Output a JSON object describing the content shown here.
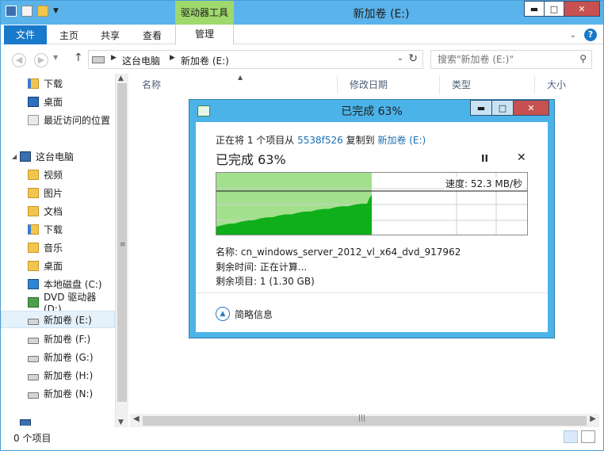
{
  "window": {
    "title": "新加卷 (E:)",
    "context_tab": "驱动器工具",
    "controls": {
      "minimize": "▬",
      "maximize": "□",
      "close": "✕"
    }
  },
  "ribbon": {
    "file_tab": "文件",
    "tabs": [
      "主页",
      "共享",
      "查看",
      "管理"
    ]
  },
  "address": {
    "crumbs": [
      "这台电脑",
      "新加卷 (E:)"
    ],
    "search_placeholder": "搜索\"新加卷 (E:)\""
  },
  "nav_pane": {
    "items": [
      {
        "label": "下载",
        "icon": "downloads-folder-icon"
      },
      {
        "label": "桌面",
        "icon": "desktop-icon"
      },
      {
        "label": "最近访问的位置",
        "icon": "recent-places-icon"
      },
      {
        "label": "这台电脑",
        "icon": "computer-icon"
      },
      {
        "label": "视频",
        "icon": "folder-icon"
      },
      {
        "label": "图片",
        "icon": "folder-icon"
      },
      {
        "label": "文档",
        "icon": "folder-icon"
      },
      {
        "label": "下载",
        "icon": "downloads-folder-icon"
      },
      {
        "label": "音乐",
        "icon": "folder-icon"
      },
      {
        "label": "桌面",
        "icon": "folder-icon"
      },
      {
        "label": "本地磁盘 (C:)",
        "icon": "system-drive-icon"
      },
      {
        "label": "DVD 驱动器 (D:)",
        "icon": "dvd-drive-icon"
      },
      {
        "label": "新加卷 (E:)",
        "icon": "drive-icon"
      },
      {
        "label": "新加卷 (F:)",
        "icon": "drive-icon"
      },
      {
        "label": "新加卷 (G:)",
        "icon": "drive-icon"
      },
      {
        "label": "新加卷 (H:)",
        "icon": "drive-icon"
      },
      {
        "label": "新加卷 (N:)",
        "icon": "drive-icon"
      }
    ]
  },
  "list_header": {
    "columns": [
      "名称",
      "修改日期",
      "类型",
      "大小"
    ]
  },
  "status": {
    "item_count": "0 个项目"
  },
  "copy_dialog": {
    "title": "已完成 63%",
    "line_prefix": "正在将 1 个项目从",
    "source": "5538f526",
    "line_mid": "复制到",
    "destination": "新加卷 (E:)",
    "progress_text": "已完成 63%",
    "progress_fraction": 0.63,
    "speed": "速度: 52.3 MB/秒",
    "name_label": "名称:",
    "name_value": "cn_windows_server_2012_vl_x64_dvd_917962",
    "time_label": "剩余时间:",
    "time_value": "正在计算...",
    "items_label": "剩余项目:",
    "items_value": "1 (1.30 GB)",
    "less_info": "简略信息",
    "pause_symbol": "II",
    "cancel_symbol": "✕"
  },
  "colors": {
    "titlebar": "#5ab3ea",
    "file_tab": "#1979ca",
    "context_tab": "#9fd86c",
    "graph_fill": "#0faf1c",
    "graph_progress_bg": "#a3e08d",
    "close_button": "#c75050"
  }
}
